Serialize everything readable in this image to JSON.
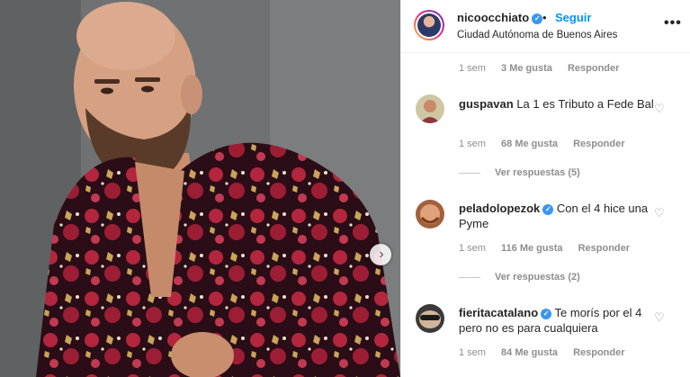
{
  "post": {
    "username": "nicoocchiato",
    "follow_label": "Seguir",
    "separator": "•",
    "location": "Ciudad Autónoma de Buenos Aires",
    "more_label": "•••"
  },
  "photo": {
    "next_glyph": "›"
  },
  "first_meta": {
    "time": "1 sem",
    "likes": "3 Me gusta",
    "reply": "Responder"
  },
  "comments": [
    {
      "username": "guspavan",
      "text": "La 1 es Tributo a Fede Bal",
      "time": "1 sem",
      "likes": "68 Me gusta",
      "reply": "Responder",
      "view_replies": "Ver respuestas (5)"
    },
    {
      "username": "peladolopezok",
      "text": "Con el 4 hice una Pyme",
      "time": "1 sem",
      "likes": "116 Me gusta",
      "reply": "Responder",
      "view_replies": "Ver respuestas (2)"
    },
    {
      "username": "fieritacatalano",
      "text": "Te morís por el 4 pero no es para cualquiera",
      "time": "1 sem",
      "likes": "84 Me gusta",
      "reply": "Responder"
    }
  ],
  "colors": {
    "link_blue": "#0095f6",
    "verified_blue": "#3897f0",
    "meta_gray": "#8e8e8e"
  },
  "icons": [
    "verified-badge-icon",
    "heart-icon",
    "more-options-icon",
    "next-arrow-icon"
  ]
}
